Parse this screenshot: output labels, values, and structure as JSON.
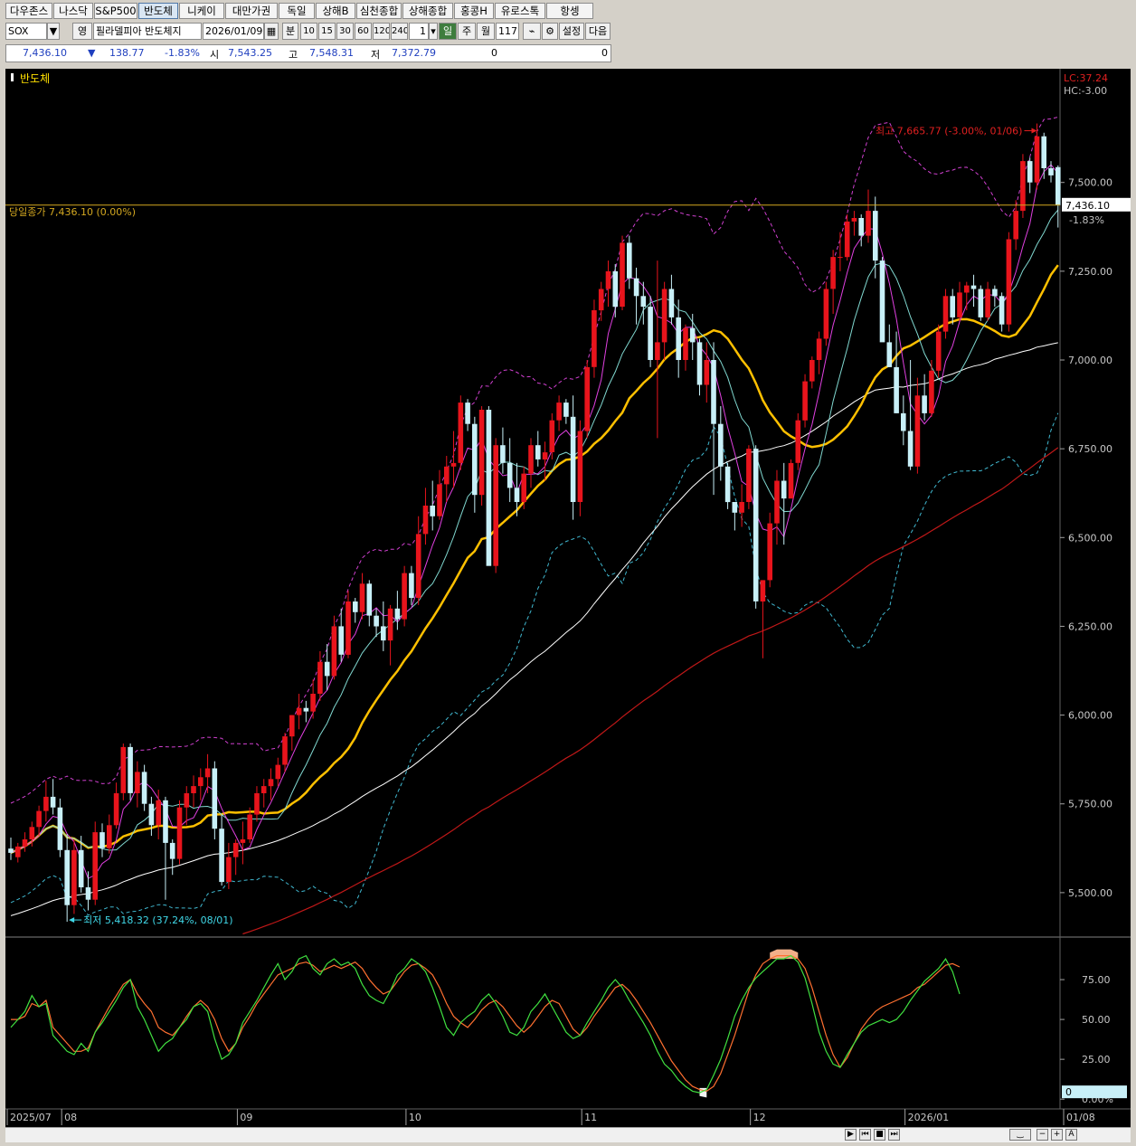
{
  "tabs": [
    "다우존스",
    "나스닥",
    "S&P500",
    "반도체",
    "니케이",
    "대만가권",
    "독일",
    "상해B",
    "심천종합",
    "상해종합",
    "홍콩H",
    "유로스톡",
    "항셍"
  ],
  "active_tab": 3,
  "controls": {
    "symbol": "SOX",
    "dropdown_arrow": "▼",
    "mode": "영",
    "name": "필라델피아 반도체지",
    "date": "2026/01/09",
    "min_label": "분",
    "periods": [
      "10",
      "15",
      "30",
      "60",
      "120",
      "240"
    ],
    "count": "1",
    "day": "일",
    "week": "주",
    "month": "월",
    "bars": "117",
    "settings": "설정",
    "next": "다음"
  },
  "quote": {
    "last": "7,436.10",
    "arrow": "▼",
    "change": "138.77",
    "pct": "-1.83%",
    "open_label": "시",
    "open": "7,543.25",
    "high_label": "고",
    "high": "7,548.31",
    "low_label": "저",
    "low": "7,372.79",
    "vol1": "0",
    "vol2": "0"
  },
  "colors": {
    "up": "#e8141c",
    "down": "#c8f0f8",
    "ma5": "#e040e0",
    "ma10": "#80d8d0",
    "ma20": "#ffc000",
    "ma60": "#ffffff",
    "ma120": "#c01818",
    "bb": "#d040d0",
    "bblow": "#40b8d0",
    "slowk": "#40e040",
    "slowd": "#ff7030",
    "hline": "#d4a820",
    "fill": "#ffb890"
  },
  "chart_data": [
    {
      "type": "candlestick",
      "title": "반도체",
      "y_ticks": [
        "7,500.00",
        "7,250.00",
        "7,000.00",
        "6,750.00",
        "6,500.00",
        "6,250.00",
        "6,000.00",
        "5,750.00",
        "5,500.00"
      ],
      "ylim": [
        5380,
        7810
      ],
      "x_ticks": [
        "2025/07",
        "08",
        "09",
        "10",
        "11",
        "12",
        "2026/01",
        "01/08"
      ],
      "current_label": "당일종가 7,436.10 (0.00%)",
      "current_price": 7436.1,
      "last_badge": "7,436.10",
      "last_badge_pct": "-1.83%",
      "lc": "LC:37.24",
      "hc": "HC:-3.00",
      "max_label": "최고 7,665.77 (-3.00%, 01/06)",
      "min_label": "최저 5,418.32 (37.24%, 08/01)",
      "candles": [
        [
          5624,
          5655,
          5592,
          5612
        ],
        [
          5600,
          5640,
          5585,
          5630
        ],
        [
          5630,
          5670,
          5615,
          5650
        ],
        [
          5650,
          5700,
          5630,
          5685
        ],
        [
          5685,
          5745,
          5660,
          5730
        ],
        [
          5730,
          5815,
          5700,
          5770
        ],
        [
          5770,
          5820,
          5720,
          5740
        ],
        [
          5740,
          5765,
          5600,
          5620
        ],
        [
          5620,
          5665,
          5418,
          5465
        ],
        [
          5465,
          5650,
          5440,
          5620
        ],
        [
          5620,
          5660,
          5500,
          5515
        ],
        [
          5515,
          5560,
          5450,
          5480
        ],
        [
          5480,
          5700,
          5465,
          5670
        ],
        [
          5670,
          5695,
          5600,
          5625
        ],
        [
          5625,
          5720,
          5610,
          5690
        ],
        [
          5690,
          5810,
          5680,
          5780
        ],
        [
          5780,
          5920,
          5760,
          5910
        ],
        [
          5910,
          5920,
          5760,
          5780
        ],
        [
          5780,
          5870,
          5740,
          5840
        ],
        [
          5840,
          5860,
          5730,
          5750
        ],
        [
          5750,
          5770,
          5660,
          5690
        ],
        [
          5690,
          5790,
          5650,
          5760
        ],
        [
          5760,
          5770,
          5480,
          5640
        ],
        [
          5640,
          5650,
          5550,
          5595
        ],
        [
          5595,
          5760,
          5580,
          5740
        ],
        [
          5740,
          5800,
          5690,
          5780
        ],
        [
          5780,
          5830,
          5740,
          5800
        ],
        [
          5800,
          5850,
          5760,
          5825
        ],
        [
          5825,
          5890,
          5780,
          5850
        ],
        [
          5850,
          5870,
          5650,
          5680
        ],
        [
          5680,
          5720,
          5520,
          5530
        ],
        [
          5530,
          5640,
          5510,
          5600
        ],
        [
          5600,
          5650,
          5550,
          5640
        ],
        [
          5640,
          5700,
          5580,
          5650
        ],
        [
          5650,
          5740,
          5640,
          5720
        ],
        [
          5720,
          5800,
          5700,
          5780
        ],
        [
          5780,
          5820,
          5740,
          5800
        ],
        [
          5800,
          5850,
          5760,
          5820
        ],
        [
          5820,
          5880,
          5800,
          5860
        ],
        [
          5860,
          5950,
          5840,
          5940
        ],
        [
          5940,
          6000,
          5900,
          6000
        ],
        [
          6000,
          6060,
          5960,
          6020
        ],
        [
          6020,
          6040,
          5980,
          6010
        ],
        [
          6010,
          6100,
          5990,
          6060
        ],
        [
          6060,
          6180,
          6040,
          6150
        ],
        [
          6150,
          6200,
          6070,
          6110
        ],
        [
          6110,
          6280,
          6100,
          6250
        ],
        [
          6250,
          6300,
          6150,
          6170
        ],
        [
          6170,
          6350,
          6160,
          6320
        ],
        [
          6320,
          6330,
          6260,
          6290
        ],
        [
          6290,
          6400,
          6270,
          6370
        ],
        [
          6370,
          6380,
          6250,
          6280
        ],
        [
          6280,
          6300,
          6220,
          6250
        ],
        [
          6250,
          6320,
          6180,
          6210
        ],
        [
          6210,
          6310,
          6140,
          6300
        ],
        [
          6300,
          6350,
          6240,
          6270
        ],
        [
          6270,
          6420,
          6250,
          6400
        ],
        [
          6400,
          6420,
          6310,
          6330
        ],
        [
          6330,
          6560,
          6310,
          6510
        ],
        [
          6510,
          6640,
          6480,
          6590
        ],
        [
          6590,
          6660,
          6520,
          6560
        ],
        [
          6560,
          6690,
          6550,
          6650
        ],
        [
          6650,
          6730,
          6600,
          6700
        ],
        [
          6700,
          6800,
          6640,
          6710
        ],
        [
          6710,
          6900,
          6690,
          6880
        ],
        [
          6880,
          6890,
          6800,
          6820
        ],
        [
          6820,
          6840,
          6570,
          6620
        ],
        [
          6620,
          6870,
          6590,
          6860
        ],
        [
          6860,
          6870,
          6430,
          6420
        ],
        [
          6420,
          6780,
          6400,
          6760
        ],
        [
          6760,
          6810,
          6680,
          6710
        ],
        [
          6710,
          6780,
          6600,
          6640
        ],
        [
          6640,
          6710,
          6560,
          6600
        ],
        [
          6600,
          6700,
          6580,
          6680
        ],
        [
          6680,
          6780,
          6640,
          6760
        ],
        [
          6760,
          6800,
          6700,
          6720
        ],
        [
          6720,
          6770,
          6660,
          6740
        ],
        [
          6740,
          6850,
          6720,
          6830
        ],
        [
          6830,
          6900,
          6800,
          6880
        ],
        [
          6880,
          6890,
          6820,
          6840
        ],
        [
          6840,
          6900,
          6550,
          6600
        ],
        [
          6600,
          6830,
          6560,
          6800
        ],
        [
          6800,
          7000,
          6780,
          6980
        ],
        [
          6980,
          7170,
          6950,
          7140
        ],
        [
          7140,
          7220,
          7110,
          7200
        ],
        [
          7200,
          7280,
          7150,
          7250
        ],
        [
          7250,
          7270,
          7120,
          7150
        ],
        [
          7150,
          7350,
          7140,
          7330
        ],
        [
          7330,
          7350,
          7200,
          7230
        ],
        [
          7230,
          7260,
          7100,
          7180
        ],
        [
          7180,
          7220,
          7100,
          7150
        ],
        [
          7150,
          7180,
          6980,
          7000
        ],
        [
          7000,
          7280,
          6780,
          7050
        ],
        [
          7050,
          7220,
          7000,
          7200
        ],
        [
          7200,
          7240,
          7100,
          7120
        ],
        [
          7120,
          7170,
          6950,
          7000
        ],
        [
          7000,
          7100,
          6970,
          7090
        ],
        [
          7090,
          7130,
          7000,
          7050
        ],
        [
          7050,
          7060,
          6900,
          6930
        ],
        [
          6930,
          7050,
          6880,
          7000
        ],
        [
          7000,
          7050,
          6620,
          6820
        ],
        [
          6820,
          6870,
          6660,
          6700
        ],
        [
          6700,
          6710,
          6580,
          6600
        ],
        [
          6600,
          6600,
          6520,
          6570
        ],
        [
          6570,
          6650,
          6530,
          6600
        ],
        [
          6600,
          6760,
          6580,
          6750
        ],
        [
          6750,
          6760,
          6300,
          6320
        ],
        [
          6320,
          6380,
          6160,
          6380
        ],
        [
          6380,
          6570,
          6360,
          6540
        ],
        [
          6540,
          6690,
          6480,
          6660
        ],
        [
          6660,
          6710,
          6480,
          6610
        ],
        [
          6610,
          6720,
          6640,
          6710
        ],
        [
          6710,
          6850,
          6690,
          6830
        ],
        [
          6830,
          6960,
          6810,
          6940
        ],
        [
          6940,
          7010,
          6920,
          7000
        ],
        [
          7000,
          7080,
          6960,
          7060
        ],
        [
          7060,
          7220,
          7040,
          7200
        ],
        [
          7200,
          7310,
          7130,
          7290
        ],
        [
          7290,
          7360,
          7250,
          7290
        ],
        [
          7290,
          7410,
          7280,
          7390
        ],
        [
          7390,
          7420,
          7350,
          7400
        ],
        [
          7400,
          7410,
          7320,
          7350
        ],
        [
          7350,
          7480,
          7330,
          7420
        ],
        [
          7420,
          7460,
          7230,
          7280
        ],
        [
          7280,
          7290,
          7060,
          7050
        ],
        [
          7050,
          7100,
          6980,
          6980
        ],
        [
          6980,
          7080,
          6850,
          6850
        ],
        [
          6850,
          6900,
          6760,
          6800
        ],
        [
          6800,
          7000,
          6690,
          6700
        ],
        [
          6700,
          6950,
          6680,
          6900
        ],
        [
          6900,
          6960,
          6830,
          6850
        ],
        [
          6850,
          7000,
          6840,
          6970
        ],
        [
          6970,
          7100,
          6950,
          7080
        ],
        [
          7080,
          7200,
          7060,
          7180
        ],
        [
          7180,
          7200,
          7100,
          7120
        ],
        [
          7120,
          7220,
          7110,
          7190
        ],
        [
          7190,
          7220,
          7140,
          7210
        ],
        [
          7210,
          7240,
          7150,
          7200
        ],
        [
          7200,
          7210,
          7110,
          7120
        ],
        [
          7120,
          7220,
          7110,
          7200
        ],
        [
          7200,
          7210,
          7150,
          7180
        ],
        [
          7180,
          7190,
          7080,
          7100
        ],
        [
          7100,
          7360,
          7080,
          7340
        ],
        [
          7340,
          7450,
          7310,
          7420
        ],
        [
          7420,
          7580,
          7400,
          7560
        ],
        [
          7560,
          7570,
          7470,
          7500
        ],
        [
          7500,
          7666,
          7480,
          7630
        ],
        [
          7630,
          7640,
          7510,
          7540
        ],
        [
          7540,
          7560,
          7500,
          7520
        ],
        [
          7543,
          7548,
          7373,
          7436
        ]
      ]
    },
    {
      "type": "line",
      "title": "",
      "y_ticks": [
        "75.00",
        "50.00",
        "25.00",
        "0.00%"
      ],
      "ylim": [
        -5,
        100
      ],
      "k_badge": "0",
      "series": [
        {
          "name": "",
          "values": [
            50,
            50,
            52,
            60,
            58,
            62,
            45,
            40,
            35,
            30,
            30,
            32,
            42,
            50,
            58,
            65,
            72,
            75,
            66,
            60,
            55,
            45,
            42,
            40,
            45,
            52,
            58,
            62,
            58,
            50,
            38,
            30,
            35,
            45,
            52,
            60,
            66,
            72,
            78,
            80,
            82,
            85,
            86,
            84,
            80,
            82,
            84,
            82,
            84,
            86,
            82,
            75,
            70,
            66,
            68,
            74,
            80,
            84,
            85,
            82,
            78,
            70,
            60,
            52,
            48,
            45,
            50,
            56,
            60,
            62,
            58,
            52,
            46,
            42,
            46,
            52,
            58,
            62,
            60,
            52,
            44,
            40,
            45,
            52,
            58,
            64,
            70,
            72,
            68,
            62,
            55,
            48,
            40,
            32,
            24,
            18,
            12,
            8,
            6,
            5,
            8,
            16,
            28,
            40,
            54,
            68,
            78,
            85,
            88,
            90,
            90,
            90,
            88,
            82,
            70,
            55,
            40,
            28,
            20,
            26,
            35,
            44,
            50,
            55,
            58,
            60,
            62,
            64,
            66,
            70,
            72,
            76,
            80,
            84,
            85,
            83
          ]
        },
        {
          "name": "",
          "values": [
            45,
            50,
            55,
            65,
            58,
            60,
            40,
            35,
            30,
            28,
            35,
            30,
            42,
            48,
            55,
            62,
            70,
            75,
            58,
            50,
            40,
            30,
            35,
            38,
            45,
            50,
            58,
            60,
            55,
            38,
            25,
            28,
            35,
            48,
            55,
            62,
            70,
            78,
            85,
            75,
            80,
            88,
            90,
            82,
            78,
            85,
            88,
            84,
            86,
            82,
            72,
            65,
            62,
            60,
            68,
            78,
            82,
            88,
            85,
            80,
            70,
            58,
            45,
            40,
            48,
            52,
            55,
            62,
            66,
            60,
            52,
            42,
            40,
            45,
            55,
            60,
            66,
            58,
            50,
            42,
            38,
            40,
            48,
            55,
            62,
            70,
            75,
            70,
            62,
            55,
            48,
            40,
            30,
            22,
            18,
            12,
            8,
            5,
            4,
            6,
            15,
            25,
            38,
            52,
            62,
            70,
            76,
            80,
            84,
            88,
            88,
            90,
            86,
            76,
            60,
            42,
            30,
            22,
            20,
            28,
            35,
            42,
            46,
            48,
            50,
            48,
            50,
            55,
            62,
            68,
            74,
            78,
            82,
            88,
            80,
            66
          ]
        }
      ]
    }
  ]
}
